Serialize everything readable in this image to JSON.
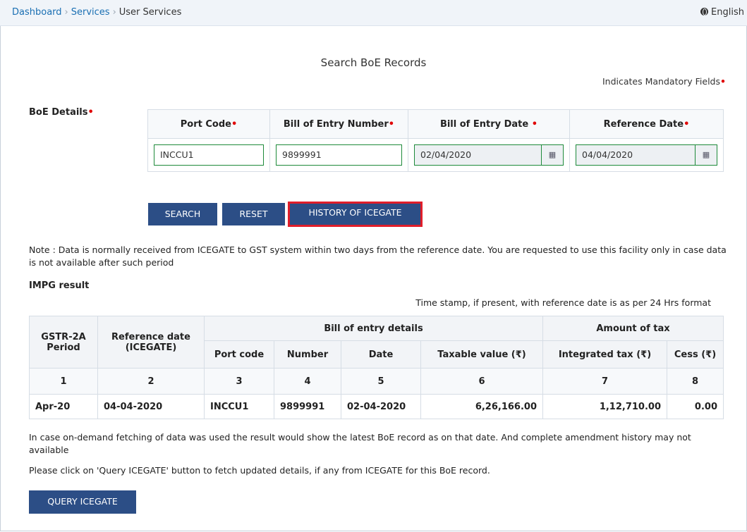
{
  "breadcrumb": {
    "items": [
      "Dashboard",
      "Services",
      "User Services"
    ],
    "separator": "›"
  },
  "language": {
    "label": "English",
    "icon": "globe-icon"
  },
  "page": {
    "title": "Search BoE Records",
    "mandatory_note": "Indicates Mandatory Fields",
    "required_mark": "•"
  },
  "boe": {
    "section_label": "BoE Details",
    "columns": [
      "Port Code",
      "Bill of Entry Number",
      "Bill of Entry Date ",
      "Reference Date"
    ],
    "values": {
      "port_code": "INCCU1",
      "bill_number": "9899991",
      "bill_date": "02/04/2020",
      "reference_date": "04/04/2020"
    },
    "calendar_icon": "calendar-icon"
  },
  "buttons": {
    "search": "SEARCH",
    "reset": "RESET",
    "history": "HISTORY OF ICEGATE",
    "query": "QUERY ICEGATE"
  },
  "note": "Note : Data is normally received from ICEGATE to GST system within two days from the reference date. You are requested to use this facility only in case data is not available after such period",
  "impg": {
    "title": "IMPG result",
    "timestamp_note": "Time stamp, if present, with reference date is as per 24 Hrs format",
    "headers": {
      "period": "GSTR-2A Period",
      "reference": "Reference date (ICEGATE)",
      "bill_group": "Bill of entry details",
      "tax_group": "Amount of tax",
      "port": "Port code",
      "number": "Number",
      "date": "Date",
      "taxable": "Taxable value (₹)",
      "integrated": "Integrated tax (₹)",
      "cess": "Cess (₹)"
    },
    "indices": [
      "1",
      "2",
      "3",
      "4",
      "5",
      "6",
      "7",
      "8"
    ],
    "rows": [
      {
        "period": "Apr-20",
        "reference": "04-04-2020",
        "port": "INCCU1",
        "number": "9899991",
        "date": "02-04-2020",
        "taxable": "6,26,166.00",
        "integrated": "1,12,710.00",
        "cess": "0.00"
      }
    ]
  },
  "info_text_1": "In case on-demand fetching of data was used the result would show the latest BoE record as on that date. And complete amendment history may not available",
  "info_text_2": "Please click on 'Query ICEGATE' button to fetch updated details, if any from ICEGATE for this BoE record."
}
